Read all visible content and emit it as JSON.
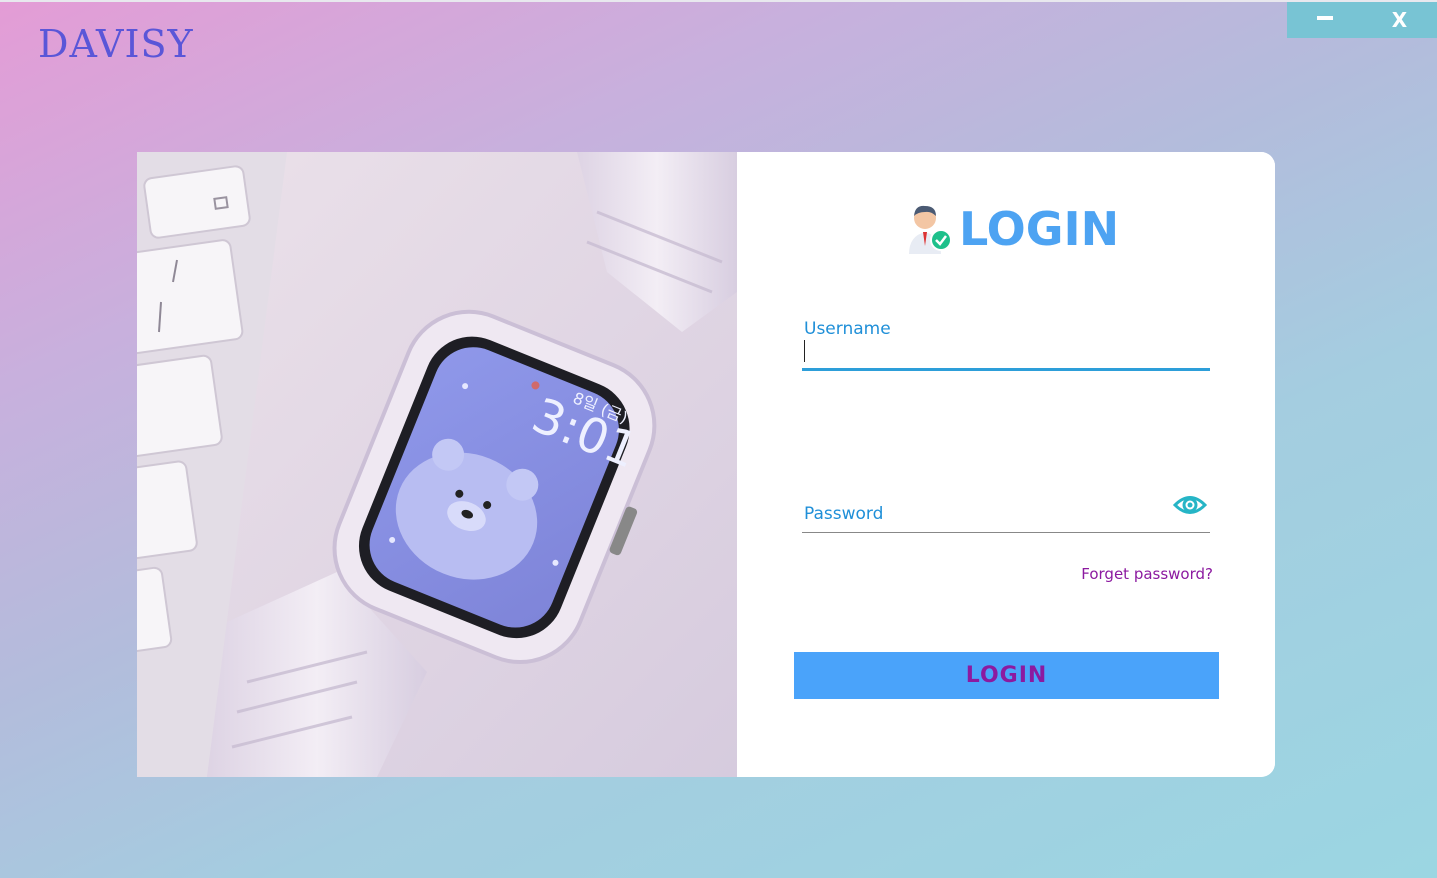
{
  "app": {
    "brand": "DAVISY"
  },
  "window_controls": {
    "minimize_icon": "minus-icon",
    "close_label": "X"
  },
  "login": {
    "title": "LOGIN",
    "avatar_icon": "user-verified-icon",
    "username_label": "Username",
    "username_value": "",
    "password_label": "Password",
    "password_value": "",
    "show_password_icon": "eye-icon",
    "forget_link": "Forget password?",
    "submit_label": "LOGIN"
  },
  "photo": {
    "subject": "watch-photo",
    "watch_time": "3:01",
    "watch_date": "8일 (금)"
  },
  "colors": {
    "accent": "#4aa3fa",
    "title": "#4da3f2",
    "link": "#8c1aa0",
    "brand": "#5a56d8",
    "window_controls": "#78c4d4"
  }
}
